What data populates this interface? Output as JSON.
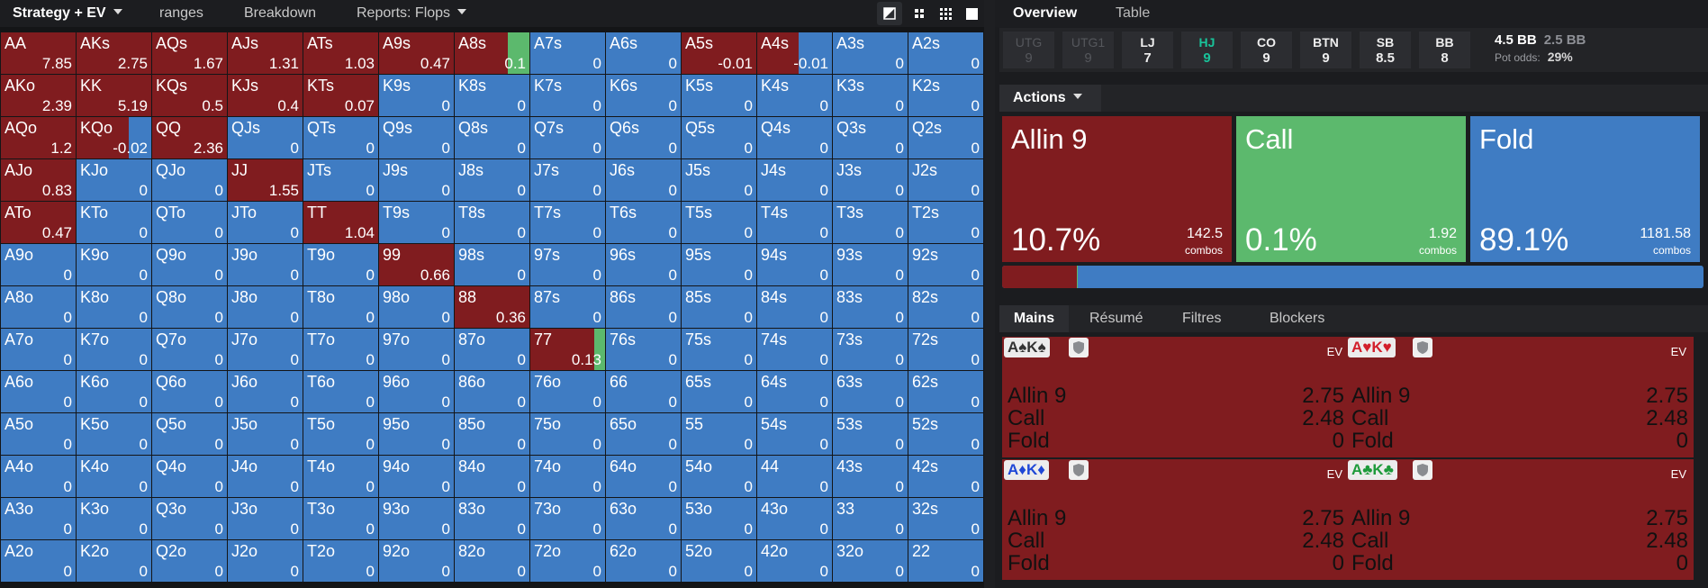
{
  "colors": {
    "allin": "#801c1f",
    "call": "#5cb96d",
    "fold": "#3f7cc3",
    "highlight": "#19c39a"
  },
  "nav": {
    "strategy_label": "Strategy + EV",
    "ranges_label": "ranges",
    "breakdown_label": "Breakdown",
    "reports_label": "Reports: Flops"
  },
  "grid": [
    [
      [
        "AA",
        "7.85",
        100,
        0
      ],
      [
        "AKs",
        "2.75",
        100,
        0
      ],
      [
        "AQs",
        "1.67",
        100,
        0
      ],
      [
        "AJs",
        "1.31",
        100,
        0
      ],
      [
        "ATs",
        "1.03",
        100,
        0
      ],
      [
        "A9s",
        "0.47",
        100,
        0
      ],
      [
        "A8s",
        "0.1",
        71,
        29
      ],
      [
        "A7s",
        "0",
        0,
        0
      ],
      [
        "A6s",
        "0",
        0,
        0
      ],
      [
        "A5s",
        "-0.01",
        100,
        0
      ],
      [
        "A4s",
        "-0.01",
        55,
        0
      ],
      [
        "A3s",
        "0",
        0,
        0
      ],
      [
        "A2s",
        "0",
        0,
        0
      ]
    ],
    [
      [
        "AKo",
        "2.39",
        100,
        0
      ],
      [
        "KK",
        "5.19",
        100,
        0
      ],
      [
        "KQs",
        "0.5",
        100,
        0
      ],
      [
        "KJs",
        "0.4",
        100,
        0
      ],
      [
        "KTs",
        "0.07",
        100,
        0
      ],
      [
        "K9s",
        "0",
        0,
        0
      ],
      [
        "K8s",
        "0",
        0,
        0
      ],
      [
        "K7s",
        "0",
        0,
        0
      ],
      [
        "K6s",
        "0",
        0,
        0
      ],
      [
        "K5s",
        "0",
        0,
        0
      ],
      [
        "K4s",
        "0",
        0,
        0
      ],
      [
        "K3s",
        "0",
        0,
        0
      ],
      [
        "K2s",
        "0",
        0,
        0
      ]
    ],
    [
      [
        "AQo",
        "1.2",
        100,
        0
      ],
      [
        "KQo",
        "-0.02",
        70,
        0
      ],
      [
        "QQ",
        "2.36",
        100,
        0
      ],
      [
        "QJs",
        "0",
        0,
        0
      ],
      [
        "QTs",
        "0",
        0,
        0
      ],
      [
        "Q9s",
        "0",
        0,
        0
      ],
      [
        "Q8s",
        "0",
        0,
        0
      ],
      [
        "Q7s",
        "0",
        0,
        0
      ],
      [
        "Q6s",
        "0",
        0,
        0
      ],
      [
        "Q5s",
        "0",
        0,
        0
      ],
      [
        "Q4s",
        "0",
        0,
        0
      ],
      [
        "Q3s",
        "0",
        0,
        0
      ],
      [
        "Q2s",
        "0",
        0,
        0
      ]
    ],
    [
      [
        "AJo",
        "0.83",
        100,
        0
      ],
      [
        "KJo",
        "0",
        0,
        0
      ],
      [
        "QJo",
        "0",
        0,
        0
      ],
      [
        "JJ",
        "1.55",
        100,
        0
      ],
      [
        "JTs",
        "0",
        0,
        0
      ],
      [
        "J9s",
        "0",
        0,
        0
      ],
      [
        "J8s",
        "0",
        0,
        0
      ],
      [
        "J7s",
        "0",
        0,
        0
      ],
      [
        "J6s",
        "0",
        0,
        0
      ],
      [
        "J5s",
        "0",
        0,
        0
      ],
      [
        "J4s",
        "0",
        0,
        0
      ],
      [
        "J3s",
        "0",
        0,
        0
      ],
      [
        "J2s",
        "0",
        0,
        0
      ]
    ],
    [
      [
        "ATo",
        "0.47",
        100,
        0
      ],
      [
        "KTo",
        "0",
        0,
        0
      ],
      [
        "QTo",
        "0",
        0,
        0
      ],
      [
        "JTo",
        "0",
        0,
        0
      ],
      [
        "TT",
        "1.04",
        100,
        0
      ],
      [
        "T9s",
        "0",
        0,
        0
      ],
      [
        "T8s",
        "0",
        0,
        0
      ],
      [
        "T7s",
        "0",
        0,
        0
      ],
      [
        "T6s",
        "0",
        0,
        0
      ],
      [
        "T5s",
        "0",
        0,
        0
      ],
      [
        "T4s",
        "0",
        0,
        0
      ],
      [
        "T3s",
        "0",
        0,
        0
      ],
      [
        "T2s",
        "0",
        0,
        0
      ]
    ],
    [
      [
        "A9o",
        "0",
        0,
        0
      ],
      [
        "K9o",
        "0",
        0,
        0
      ],
      [
        "Q9o",
        "0",
        0,
        0
      ],
      [
        "J9o",
        "0",
        0,
        0
      ],
      [
        "T9o",
        "0",
        0,
        0
      ],
      [
        "99",
        "0.66",
        100,
        0
      ],
      [
        "98s",
        "0",
        0,
        0
      ],
      [
        "97s",
        "0",
        0,
        0
      ],
      [
        "96s",
        "0",
        0,
        0
      ],
      [
        "95s",
        "0",
        0,
        0
      ],
      [
        "94s",
        "0",
        0,
        0
      ],
      [
        "93s",
        "0",
        0,
        0
      ],
      [
        "92s",
        "0",
        0,
        0
      ]
    ],
    [
      [
        "A8o",
        "0",
        0,
        0
      ],
      [
        "K8o",
        "0",
        0,
        0
      ],
      [
        "Q8o",
        "0",
        0,
        0
      ],
      [
        "J8o",
        "0",
        0,
        0
      ],
      [
        "T8o",
        "0",
        0,
        0
      ],
      [
        "98o",
        "0",
        0,
        0
      ],
      [
        "88",
        "0.36",
        100,
        0
      ],
      [
        "87s",
        "0",
        0,
        0
      ],
      [
        "86s",
        "0",
        0,
        0
      ],
      [
        "85s",
        "0",
        0,
        0
      ],
      [
        "84s",
        "0",
        0,
        0
      ],
      [
        "83s",
        "0",
        0,
        0
      ],
      [
        "82s",
        "0",
        0,
        0
      ]
    ],
    [
      [
        "A7o",
        "0",
        0,
        0
      ],
      [
        "K7o",
        "0",
        0,
        0
      ],
      [
        "Q7o",
        "0",
        0,
        0
      ],
      [
        "J7o",
        "0",
        0,
        0
      ],
      [
        "T7o",
        "0",
        0,
        0
      ],
      [
        "97o",
        "0",
        0,
        0
      ],
      [
        "87o",
        "0",
        0,
        0
      ],
      [
        "77",
        "0.13",
        86,
        14
      ],
      [
        "76s",
        "0",
        0,
        0
      ],
      [
        "75s",
        "0",
        0,
        0
      ],
      [
        "74s",
        "0",
        0,
        0
      ],
      [
        "73s",
        "0",
        0,
        0
      ],
      [
        "72s",
        "0",
        0,
        0
      ]
    ],
    [
      [
        "A6o",
        "0",
        0,
        0
      ],
      [
        "K6o",
        "0",
        0,
        0
      ],
      [
        "Q6o",
        "0",
        0,
        0
      ],
      [
        "J6o",
        "0",
        0,
        0
      ],
      [
        "T6o",
        "0",
        0,
        0
      ],
      [
        "96o",
        "0",
        0,
        0
      ],
      [
        "86o",
        "0",
        0,
        0
      ],
      [
        "76o",
        "0",
        0,
        0
      ],
      [
        "66",
        "0",
        0,
        0
      ],
      [
        "65s",
        "0",
        0,
        0
      ],
      [
        "64s",
        "0",
        0,
        0
      ],
      [
        "63s",
        "0",
        0,
        0
      ],
      [
        "62s",
        "0",
        0,
        0
      ]
    ],
    [
      [
        "A5o",
        "0",
        0,
        0
      ],
      [
        "K5o",
        "0",
        0,
        0
      ],
      [
        "Q5o",
        "0",
        0,
        0
      ],
      [
        "J5o",
        "0",
        0,
        0
      ],
      [
        "T5o",
        "0",
        0,
        0
      ],
      [
        "95o",
        "0",
        0,
        0
      ],
      [
        "85o",
        "0",
        0,
        0
      ],
      [
        "75o",
        "0",
        0,
        0
      ],
      [
        "65o",
        "0",
        0,
        0
      ],
      [
        "55",
        "0",
        0,
        0
      ],
      [
        "54s",
        "0",
        0,
        0
      ],
      [
        "53s",
        "0",
        0,
        0
      ],
      [
        "52s",
        "0",
        0,
        0
      ]
    ],
    [
      [
        "A4o",
        "0",
        0,
        0
      ],
      [
        "K4o",
        "0",
        0,
        0
      ],
      [
        "Q4o",
        "0",
        0,
        0
      ],
      [
        "J4o",
        "0",
        0,
        0
      ],
      [
        "T4o",
        "0",
        0,
        0
      ],
      [
        "94o",
        "0",
        0,
        0
      ],
      [
        "84o",
        "0",
        0,
        0
      ],
      [
        "74o",
        "0",
        0,
        0
      ],
      [
        "64o",
        "0",
        0,
        0
      ],
      [
        "54o",
        "0",
        0,
        0
      ],
      [
        "44",
        "0",
        0,
        0
      ],
      [
        "43s",
        "0",
        0,
        0
      ],
      [
        "42s",
        "0",
        0,
        0
      ]
    ],
    [
      [
        "A3o",
        "0",
        0,
        0
      ],
      [
        "K3o",
        "0",
        0,
        0
      ],
      [
        "Q3o",
        "0",
        0,
        0
      ],
      [
        "J3o",
        "0",
        0,
        0
      ],
      [
        "T3o",
        "0",
        0,
        0
      ],
      [
        "93o",
        "0",
        0,
        0
      ],
      [
        "83o",
        "0",
        0,
        0
      ],
      [
        "73o",
        "0",
        0,
        0
      ],
      [
        "63o",
        "0",
        0,
        0
      ],
      [
        "53o",
        "0",
        0,
        0
      ],
      [
        "43o",
        "0",
        0,
        0
      ],
      [
        "33",
        "0",
        0,
        0
      ],
      [
        "32s",
        "0",
        0,
        0
      ]
    ],
    [
      [
        "A2o",
        "0",
        0,
        0
      ],
      [
        "K2o",
        "0",
        0,
        0
      ],
      [
        "Q2o",
        "0",
        0,
        0
      ],
      [
        "J2o",
        "0",
        0,
        0
      ],
      [
        "T2o",
        "0",
        0,
        0
      ],
      [
        "92o",
        "0",
        0,
        0
      ],
      [
        "82o",
        "0",
        0,
        0
      ],
      [
        "72o",
        "0",
        0,
        0
      ],
      [
        "62o",
        "0",
        0,
        0
      ],
      [
        "52o",
        "0",
        0,
        0
      ],
      [
        "42o",
        "0",
        0,
        0
      ],
      [
        "32o",
        "0",
        0,
        0
      ],
      [
        "22",
        "0",
        0,
        0
      ]
    ]
  ],
  "right_tabs": {
    "overview": "Overview",
    "table": "Table"
  },
  "positions": [
    {
      "name": "UTG",
      "stack": "9",
      "state": "dim"
    },
    {
      "name": "UTG1",
      "stack": "9",
      "state": "dim"
    },
    {
      "name": "LJ",
      "stack": "7",
      "state": "norm"
    },
    {
      "name": "HJ",
      "stack": "9",
      "state": "hl"
    },
    {
      "name": "CO",
      "stack": "9",
      "state": "norm"
    },
    {
      "name": "BTN",
      "stack": "9",
      "state": "norm"
    },
    {
      "name": "SB",
      "stack": "8.5",
      "state": "norm"
    },
    {
      "name": "BB",
      "stack": "8",
      "state": "norm"
    }
  ],
  "pot": {
    "total": "4.5 BB",
    "call": "2.5 BB",
    "odds_label": "Pot odds:",
    "odds_value": "29%"
  },
  "actions_label": "Actions",
  "actions": [
    {
      "name": "Allin 9",
      "pct": "10.7%",
      "combos": "142.5",
      "combos_label": "combos",
      "color": "#801c1f"
    },
    {
      "name": "Call",
      "pct": "0.1%",
      "combos": "1.92",
      "combos_label": "combos",
      "color": "#5cb96d"
    },
    {
      "name": "Fold",
      "pct": "89.1%",
      "combos": "1181.58",
      "combos_label": "combos",
      "color": "#3f7cc3"
    }
  ],
  "freq_fraction": [
    0.107,
    0.001,
    0.891
  ],
  "combo_tabs": {
    "mains": "Mains",
    "resume": "Résumé",
    "filtres": "Filtres",
    "blockers": "Blockers"
  },
  "combos": [
    {
      "cards": "A♠K♠",
      "suit_color": "#333333",
      "ev": "EV",
      "rows": [
        [
          "Allin 9",
          "2.75"
        ],
        [
          "Call",
          "2.48"
        ],
        [
          "Fold",
          "0"
        ]
      ]
    },
    {
      "cards": "A♥K♥",
      "suit_color": "#d21f2b",
      "ev": "EV",
      "rows": [
        [
          "Allin 9",
          "2.75"
        ],
        [
          "Call",
          "2.48"
        ],
        [
          "Fold",
          "0"
        ]
      ]
    },
    {
      "cards": "A♦K♦",
      "suit_color": "#1f47d6",
      "ev": "EV",
      "rows": [
        [
          "Allin 9",
          "2.75"
        ],
        [
          "Call",
          "2.48"
        ],
        [
          "Fold",
          "0"
        ]
      ]
    },
    {
      "cards": "A♣K♣",
      "suit_color": "#1d9a3a",
      "ev": "EV",
      "rows": [
        [
          "Allin 9",
          "2.75"
        ],
        [
          "Call",
          "2.48"
        ],
        [
          "Fold",
          "0"
        ]
      ]
    }
  ]
}
